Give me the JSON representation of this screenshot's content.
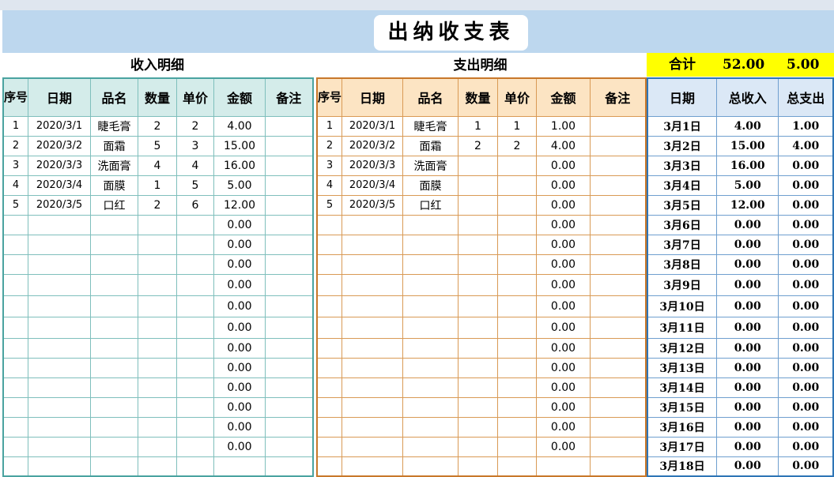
{
  "title": "出纳收支表",
  "income": {
    "section_title": "收入明细",
    "headers": [
      "序号",
      "日期",
      "品名",
      "数量",
      "单价",
      "金额",
      "备注"
    ],
    "rows": [
      [
        "1",
        "2020/3/1",
        "睫毛膏",
        "2",
        "2",
        "4.00",
        ""
      ],
      [
        "2",
        "2020/3/2",
        "面霜",
        "5",
        "3",
        "15.00",
        ""
      ],
      [
        "3",
        "2020/3/3",
        "洗面膏",
        "4",
        "4",
        "16.00",
        ""
      ],
      [
        "4",
        "2020/3/4",
        "面膜",
        "1",
        "5",
        "5.00",
        ""
      ],
      [
        "5",
        "2020/3/5",
        "口红",
        "2",
        "6",
        "12.00",
        ""
      ],
      [
        "",
        "",
        "",
        "",
        "",
        "0.00",
        ""
      ],
      [
        "",
        "",
        "",
        "",
        "",
        "0.00",
        ""
      ],
      [
        "",
        "",
        "",
        "",
        "",
        "0.00",
        ""
      ],
      [
        "",
        "",
        "",
        "",
        "",
        "0.00",
        ""
      ],
      [
        "",
        "",
        "",
        "",
        "",
        "0.00",
        ""
      ],
      [
        "",
        "",
        "",
        "",
        "",
        "0.00",
        ""
      ],
      [
        "",
        "",
        "",
        "",
        "",
        "0.00",
        ""
      ],
      [
        "",
        "",
        "",
        "",
        "",
        "0.00",
        ""
      ],
      [
        "",
        "",
        "",
        "",
        "",
        "0.00",
        ""
      ],
      [
        "",
        "",
        "",
        "",
        "",
        "0.00",
        ""
      ],
      [
        "",
        "",
        "",
        "",
        "",
        "0.00",
        ""
      ],
      [
        "",
        "",
        "",
        "",
        "",
        "0.00",
        ""
      ],
      [
        "",
        "",
        "",
        "",
        "",
        "",
        ""
      ]
    ]
  },
  "expense": {
    "section_title": "支出明细",
    "headers": [
      "序号",
      "日期",
      "品名",
      "数量",
      "单价",
      "金额",
      "备注"
    ],
    "rows": [
      [
        "1",
        "2020/3/1",
        "睫毛膏",
        "1",
        "1",
        "1.00",
        ""
      ],
      [
        "2",
        "2020/3/2",
        "面霜",
        "2",
        "2",
        "4.00",
        ""
      ],
      [
        "3",
        "2020/3/3",
        "洗面膏",
        "",
        "",
        "0.00",
        ""
      ],
      [
        "4",
        "2020/3/4",
        "面膜",
        "",
        "",
        "0.00",
        ""
      ],
      [
        "5",
        "2020/3/5",
        "口红",
        "",
        "",
        "0.00",
        ""
      ],
      [
        "",
        "",
        "",
        "",
        "",
        "0.00",
        ""
      ],
      [
        "",
        "",
        "",
        "",
        "",
        "0.00",
        ""
      ],
      [
        "",
        "",
        "",
        "",
        "",
        "0.00",
        ""
      ],
      [
        "",
        "",
        "",
        "",
        "",
        "0.00",
        ""
      ],
      [
        "",
        "",
        "",
        "",
        "",
        "0.00",
        ""
      ],
      [
        "",
        "",
        "",
        "",
        "",
        "0.00",
        ""
      ],
      [
        "",
        "",
        "",
        "",
        "",
        "0.00",
        ""
      ],
      [
        "",
        "",
        "",
        "",
        "",
        "0.00",
        ""
      ],
      [
        "",
        "",
        "",
        "",
        "",
        "0.00",
        ""
      ],
      [
        "",
        "",
        "",
        "",
        "",
        "0.00",
        ""
      ],
      [
        "",
        "",
        "",
        "",
        "",
        "0.00",
        ""
      ],
      [
        "",
        "",
        "",
        "",
        "",
        "0.00",
        ""
      ],
      [
        "",
        "",
        "",
        "",
        "",
        "",
        ""
      ]
    ]
  },
  "summary": {
    "total_label": "合计",
    "total_income": "52.00",
    "total_expense": "5.00",
    "headers": [
      "日期",
      "总收入",
      "总支出"
    ],
    "rows": [
      [
        "3月1日",
        "4.00",
        "1.00"
      ],
      [
        "3月2日",
        "15.00",
        "4.00"
      ],
      [
        "3月3日",
        "16.00",
        "0.00"
      ],
      [
        "3月4日",
        "5.00",
        "0.00"
      ],
      [
        "3月5日",
        "12.00",
        "0.00"
      ],
      [
        "3月6日",
        "0.00",
        "0.00"
      ],
      [
        "3月7日",
        "0.00",
        "0.00"
      ],
      [
        "3月8日",
        "0.00",
        "0.00"
      ],
      [
        "3月9日",
        "0.00",
        "0.00"
      ],
      [
        "3月10日",
        "0.00",
        "0.00"
      ],
      [
        "3月11日",
        "0.00",
        "0.00"
      ],
      [
        "3月12日",
        "0.00",
        "0.00"
      ],
      [
        "3月13日",
        "0.00",
        "0.00"
      ],
      [
        "3月14日",
        "0.00",
        "0.00"
      ],
      [
        "3月15日",
        "0.00",
        "0.00"
      ],
      [
        "3月16日",
        "0.00",
        "0.00"
      ],
      [
        "3月17日",
        "0.00",
        "0.00"
      ],
      [
        "3月18日",
        "0.00",
        "0.00"
      ]
    ]
  }
}
